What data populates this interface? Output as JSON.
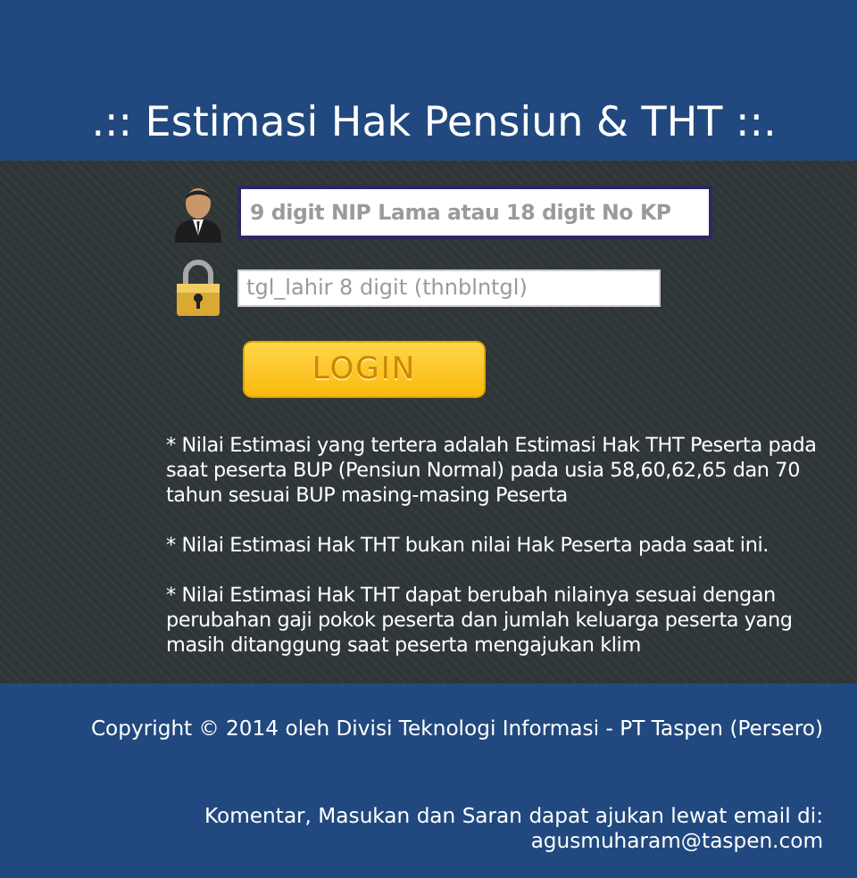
{
  "header": {
    "title": ".:: Estimasi Hak Pensiun & THT ::."
  },
  "login": {
    "fields": [
      {
        "kind": "user",
        "placeholder": "9 digit NIP Lama atau 18 digit No KP"
      },
      {
        "kind": "password",
        "placeholder": "tgl_lahir 8 digit (thnblntgl)"
      }
    ],
    "button": "LOGIN"
  },
  "notes": [
    "* Nilai Estimasi yang tertera adalah Estimasi Hak THT Peserta pada saat peserta BUP (Pensiun Normal) pada usia 58,60,62,65 dan 70 tahun sesuai BUP masing-masing Peserta",
    "* Nilai Estimasi Hak THT bukan nilai Hak Peserta pada saat ini.",
    "* Nilai Estimasi Hak THT dapat berubah nilainya sesuai dengan perubahan gaji pokok peserta dan jumlah keluarga peserta yang masih ditanggung saat peserta mengajukan klim"
  ],
  "footer": {
    "copyright": "Copyright © 2014 oleh Divisi Teknologi Informasi - PT Taspen (Persero)",
    "contact": "Komentar, Masukan dan Saran dapat ajukan lewat email di:",
    "email": "agusmuharam@taspen.com"
  }
}
